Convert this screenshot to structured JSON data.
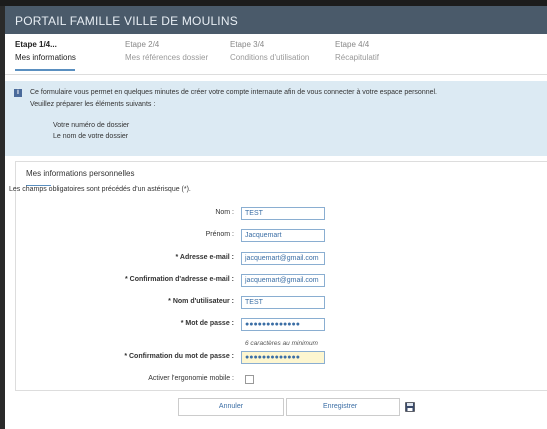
{
  "header": {
    "title": "PORTAIL FAMILLE VILLE DE MOULINS"
  },
  "steps": [
    {
      "num": "Etape 1/4...",
      "name": "Mes informations"
    },
    {
      "num": "Etape 2/4",
      "name": "Mes références dossier"
    },
    {
      "num": "Etape 3/4",
      "name": "Conditions d'utilisation"
    },
    {
      "num": "Etape 4/4",
      "name": "Récapitulatif"
    }
  ],
  "info": {
    "text": "Ce formulaire vous permet en quelques minutes de créer votre compte internaute afin de vous connecter à votre espace personnel.",
    "sub": "Veuillez préparer les éléments suivants :",
    "items": [
      "Votre numéro de dossier",
      "Le nom de votre dossier"
    ]
  },
  "form": {
    "title": "Mes informations personnelles",
    "required_note": "Les champs obligatoires sont précédés d'un astérisque (*).",
    "fields": [
      {
        "label": "Nom :",
        "value": "TEST"
      },
      {
        "label": "Prénom :",
        "value": "Jacquemart"
      },
      {
        "label": "* Adresse e-mail :",
        "value": "jacquemart@gmail.com"
      },
      {
        "label": "* Confirmation d'adresse e-mail :",
        "value": "jacquemart@gmail.com"
      },
      {
        "label": "* Nom d'utilisateur :",
        "value": "TEST"
      },
      {
        "label": "* Mot de passe :",
        "value": "●●●●●●●●●●●●●"
      },
      {
        "label": "* Confirmation du mot de passe :",
        "value": "●●●●●●●●●●●●●"
      }
    ],
    "hint": "6 caractères au minimum",
    "mobile_label": "Activer l'ergonomie mobile :"
  },
  "buttons": {
    "cancel": "Annuler",
    "save": "Enregistrer"
  },
  "colors": {
    "header": "#4a5a6a",
    "info_bg": "#dceaf3",
    "accent": "#3b6ea5"
  }
}
